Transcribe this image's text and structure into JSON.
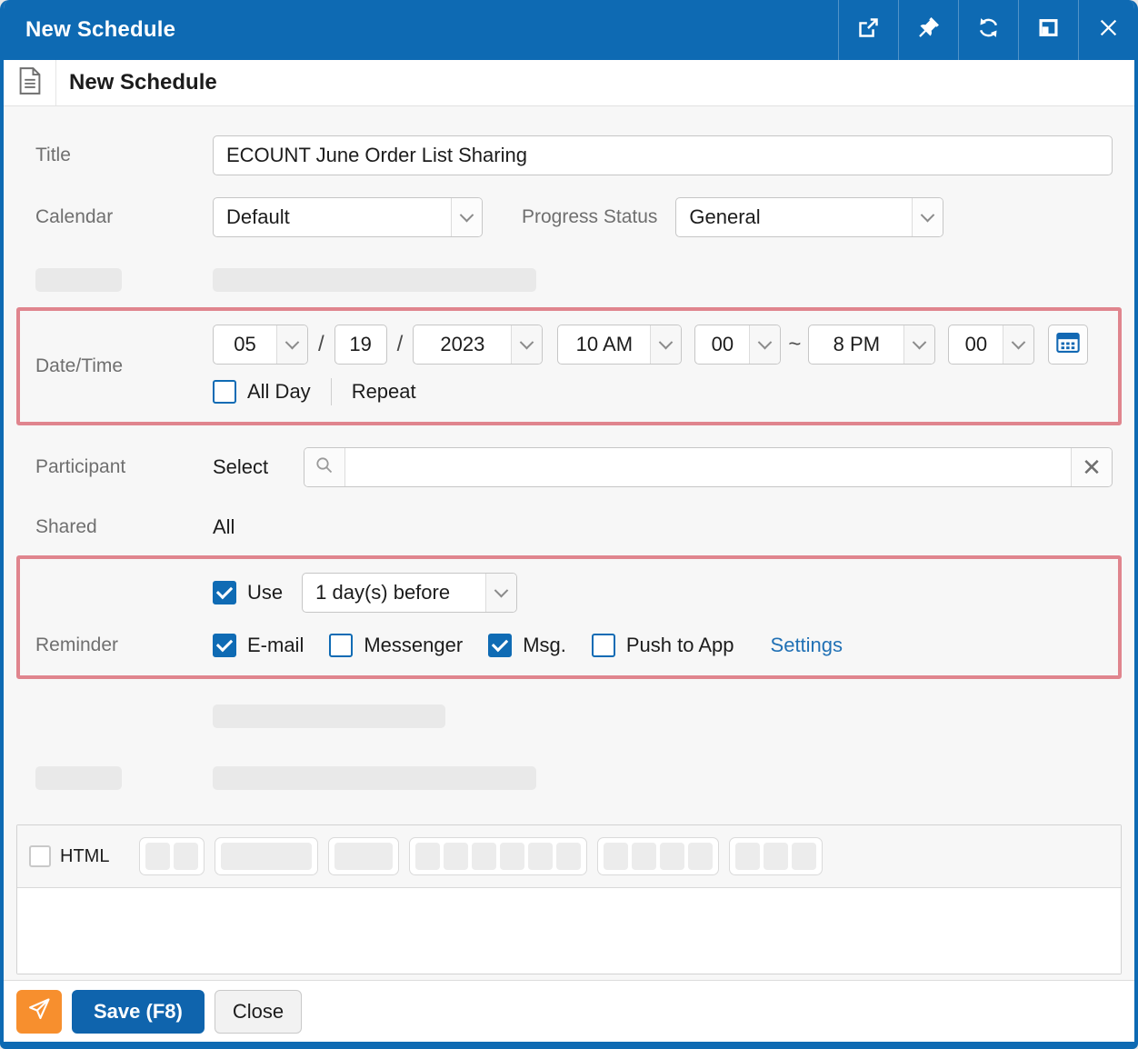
{
  "window": {
    "title": "New Schedule",
    "titlebar_icons": [
      "open-in-new-window",
      "pin",
      "refresh",
      "maximize",
      "close"
    ]
  },
  "breadcrumb": {
    "title": "New Schedule"
  },
  "form": {
    "title": {
      "label": "Title",
      "value": "ECOUNT June Order List Sharing"
    },
    "calendar": {
      "label": "Calendar",
      "value": "Default"
    },
    "progress_status": {
      "label": "Progress Status",
      "value": "General"
    },
    "datetime": {
      "label": "Date/Time",
      "month": "05",
      "day": "19",
      "year": "2023",
      "start_hour": "10 AM",
      "start_minute": "00",
      "end_hour": "8 PM",
      "end_minute": "00",
      "slash": "/",
      "tilde": "~",
      "all_day": {
        "label": "All Day",
        "checked": false
      },
      "repeat_label": "Repeat"
    },
    "participant": {
      "label": "Participant",
      "select_label": "Select",
      "value": "",
      "clear_glyph": "✕"
    },
    "shared": {
      "label": "Shared",
      "value": "All"
    },
    "reminder": {
      "label": "Reminder",
      "use": {
        "label": "Use",
        "checked": true
      },
      "timing_value": "1 day(s) before",
      "channels": [
        {
          "label": "E-mail",
          "checked": true
        },
        {
          "label": "Messenger",
          "checked": false
        },
        {
          "label": "Msg.",
          "checked": true
        },
        {
          "label": "Push to App",
          "checked": false
        }
      ],
      "settings_label": "Settings"
    },
    "html_editor": {
      "checkbox_label": "HTML",
      "checked": false
    }
  },
  "footer": {
    "save_label": "Save (F8)",
    "close_label": "Close"
  },
  "colors": {
    "titlebar_blue": "#0e6ab3",
    "accent_blue": "#0f6bb4",
    "save_blue": "#0f64ad",
    "highlight_border": "#e0858e",
    "send_orange": "#f78f2e",
    "link_blue": "#2171b5",
    "content_bg": "#f7f7f7",
    "placeholder_gray": "#e9e9e9"
  }
}
